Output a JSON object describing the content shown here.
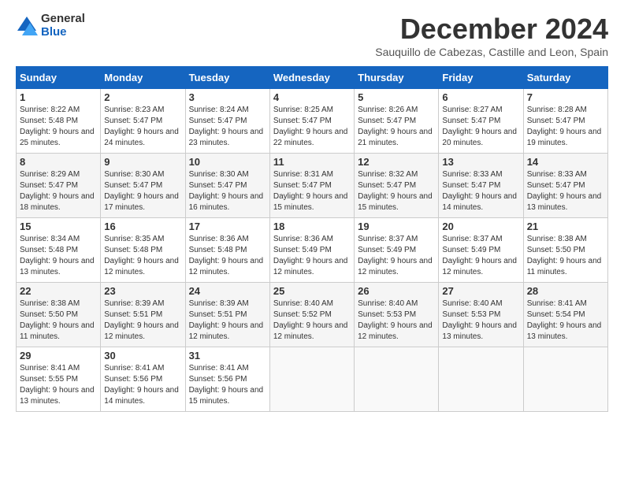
{
  "header": {
    "logo_line1": "General",
    "logo_line2": "Blue",
    "month_title": "December 2024",
    "subtitle": "Sauquillo de Cabezas, Castille and Leon, Spain"
  },
  "weekdays": [
    "Sunday",
    "Monday",
    "Tuesday",
    "Wednesday",
    "Thursday",
    "Friday",
    "Saturday"
  ],
  "weeks": [
    [
      {
        "day": "1",
        "sunrise": "8:22 AM",
        "sunset": "5:48 PM",
        "daylight": "9 hours and 25 minutes."
      },
      {
        "day": "2",
        "sunrise": "8:23 AM",
        "sunset": "5:47 PM",
        "daylight": "9 hours and 24 minutes."
      },
      {
        "day": "3",
        "sunrise": "8:24 AM",
        "sunset": "5:47 PM",
        "daylight": "9 hours and 23 minutes."
      },
      {
        "day": "4",
        "sunrise": "8:25 AM",
        "sunset": "5:47 PM",
        "daylight": "9 hours and 22 minutes."
      },
      {
        "day": "5",
        "sunrise": "8:26 AM",
        "sunset": "5:47 PM",
        "daylight": "9 hours and 21 minutes."
      },
      {
        "day": "6",
        "sunrise": "8:27 AM",
        "sunset": "5:47 PM",
        "daylight": "9 hours and 20 minutes."
      },
      {
        "day": "7",
        "sunrise": "8:28 AM",
        "sunset": "5:47 PM",
        "daylight": "9 hours and 19 minutes."
      }
    ],
    [
      {
        "day": "8",
        "sunrise": "8:29 AM",
        "sunset": "5:47 PM",
        "daylight": "9 hours and 18 minutes."
      },
      {
        "day": "9",
        "sunrise": "8:30 AM",
        "sunset": "5:47 PM",
        "daylight": "9 hours and 17 minutes."
      },
      {
        "day": "10",
        "sunrise": "8:30 AM",
        "sunset": "5:47 PM",
        "daylight": "9 hours and 16 minutes."
      },
      {
        "day": "11",
        "sunrise": "8:31 AM",
        "sunset": "5:47 PM",
        "daylight": "9 hours and 15 minutes."
      },
      {
        "day": "12",
        "sunrise": "8:32 AM",
        "sunset": "5:47 PM",
        "daylight": "9 hours and 15 minutes."
      },
      {
        "day": "13",
        "sunrise": "8:33 AM",
        "sunset": "5:47 PM",
        "daylight": "9 hours and 14 minutes."
      },
      {
        "day": "14",
        "sunrise": "8:33 AM",
        "sunset": "5:47 PM",
        "daylight": "9 hours and 13 minutes."
      }
    ],
    [
      {
        "day": "15",
        "sunrise": "8:34 AM",
        "sunset": "5:48 PM",
        "daylight": "9 hours and 13 minutes."
      },
      {
        "day": "16",
        "sunrise": "8:35 AM",
        "sunset": "5:48 PM",
        "daylight": "9 hours and 12 minutes."
      },
      {
        "day": "17",
        "sunrise": "8:36 AM",
        "sunset": "5:48 PM",
        "daylight": "9 hours and 12 minutes."
      },
      {
        "day": "18",
        "sunrise": "8:36 AM",
        "sunset": "5:49 PM",
        "daylight": "9 hours and 12 minutes."
      },
      {
        "day": "19",
        "sunrise": "8:37 AM",
        "sunset": "5:49 PM",
        "daylight": "9 hours and 12 minutes."
      },
      {
        "day": "20",
        "sunrise": "8:37 AM",
        "sunset": "5:49 PM",
        "daylight": "9 hours and 12 minutes."
      },
      {
        "day": "21",
        "sunrise": "8:38 AM",
        "sunset": "5:50 PM",
        "daylight": "9 hours and 11 minutes."
      }
    ],
    [
      {
        "day": "22",
        "sunrise": "8:38 AM",
        "sunset": "5:50 PM",
        "daylight": "9 hours and 11 minutes."
      },
      {
        "day": "23",
        "sunrise": "8:39 AM",
        "sunset": "5:51 PM",
        "daylight": "9 hours and 12 minutes."
      },
      {
        "day": "24",
        "sunrise": "8:39 AM",
        "sunset": "5:51 PM",
        "daylight": "9 hours and 12 minutes."
      },
      {
        "day": "25",
        "sunrise": "8:40 AM",
        "sunset": "5:52 PM",
        "daylight": "9 hours and 12 minutes."
      },
      {
        "day": "26",
        "sunrise": "8:40 AM",
        "sunset": "5:53 PM",
        "daylight": "9 hours and 12 minutes."
      },
      {
        "day": "27",
        "sunrise": "8:40 AM",
        "sunset": "5:53 PM",
        "daylight": "9 hours and 13 minutes."
      },
      {
        "day": "28",
        "sunrise": "8:41 AM",
        "sunset": "5:54 PM",
        "daylight": "9 hours and 13 minutes."
      }
    ],
    [
      {
        "day": "29",
        "sunrise": "8:41 AM",
        "sunset": "5:55 PM",
        "daylight": "9 hours and 13 minutes."
      },
      {
        "day": "30",
        "sunrise": "8:41 AM",
        "sunset": "5:56 PM",
        "daylight": "9 hours and 14 minutes."
      },
      {
        "day": "31",
        "sunrise": "8:41 AM",
        "sunset": "5:56 PM",
        "daylight": "9 hours and 15 minutes."
      },
      null,
      null,
      null,
      null
    ]
  ]
}
